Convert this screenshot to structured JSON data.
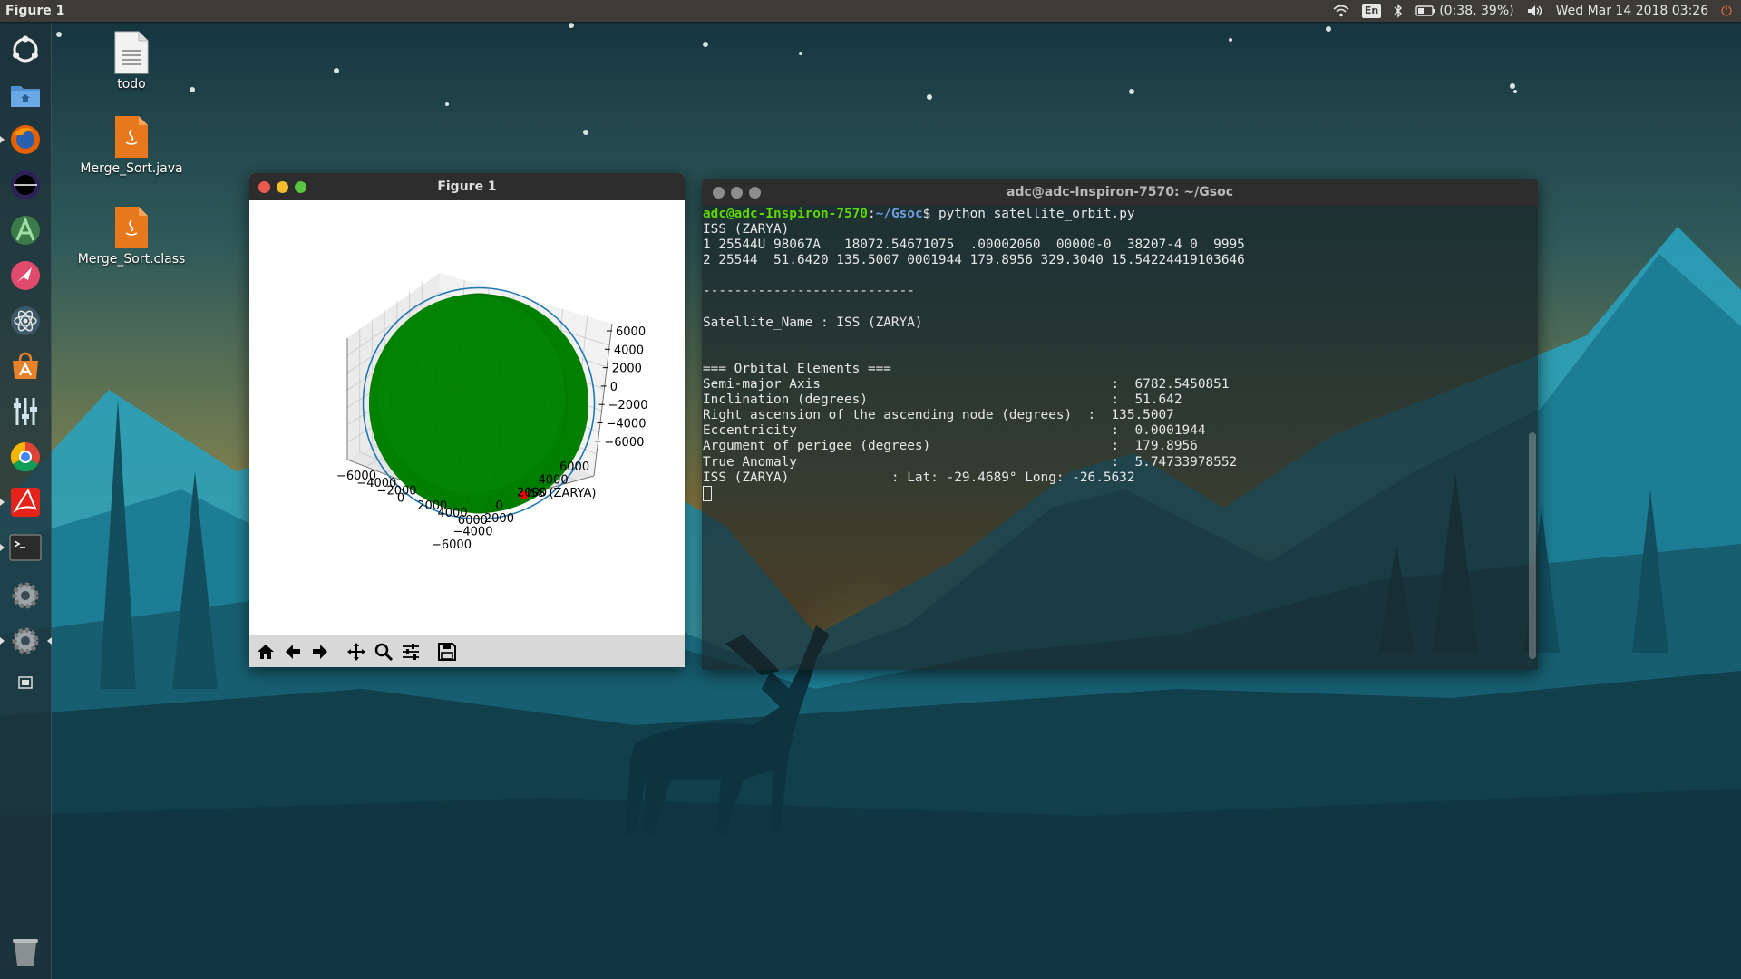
{
  "top_panel": {
    "active_app": "Figure 1",
    "language": "En",
    "battery": "(0:38, 39%)",
    "datetime": "Wed Mar 14 2018 03:26",
    "icons": [
      "wifi-icon",
      "bluetooth-icon",
      "battery-icon",
      "volume-icon",
      "power-icon"
    ]
  },
  "launcher": {
    "items": [
      "ubuntu-dash",
      "files",
      "firefox",
      "eclipse",
      "android-studio",
      "remote-desktop",
      "atom",
      "software-center",
      "mixer",
      "chrome",
      "pdf-reader",
      "terminal",
      "settings",
      "system-settings",
      "workspaces",
      "trash"
    ]
  },
  "desktop_icons": [
    {
      "label": "todo",
      "type": "text-file"
    },
    {
      "label": "Merge_Sort.java",
      "type": "java-file"
    },
    {
      "label": "Merge_Sort.class",
      "type": "java-file"
    }
  ],
  "figure_window": {
    "title": "Figure 1",
    "toolbar": [
      "home",
      "back",
      "forward",
      "pan",
      "zoom",
      "configure",
      "save"
    ]
  },
  "chart_data": {
    "type": "scatter",
    "title": "",
    "plot": "3d",
    "xlim": [
      -6000,
      6000
    ],
    "ylim": [
      -6000,
      6000
    ],
    "zlim": [
      -6000,
      6000
    ],
    "x_ticks": [
      "−6000",
      "−4000",
      "−2000",
      "0",
      "2000",
      "4000",
      "6000"
    ],
    "y_ticks": [
      "6000",
      "4000",
      "2000",
      "0",
      "−2000",
      "−4000",
      "−6000"
    ],
    "z_ticks": [
      "6000",
      "4000",
      "2000",
      "0",
      "−2000",
      "−4000",
      "−6000"
    ],
    "surface": {
      "shape": "sphere",
      "radius": 6371,
      "color": "#008000"
    },
    "orbit": {
      "semi_major_axis": 6782.5450851,
      "color": "#1f77b4"
    },
    "points": [
      {
        "label": "ISS (ZARYA)",
        "color": "#ff0000"
      }
    ]
  },
  "terminal": {
    "title": "adc@adc-Inspiron-7570: ~/Gsoc",
    "prompt_user": "adc@adc-Inspiron-7570",
    "prompt_path": "~/Gsoc",
    "command": "python satellite_orbit.py",
    "lines": [
      "ISS (ZARYA)",
      "1 25544U 98067A   18072.54671075  .00002060  00000-0  38207-4 0  9995",
      "2 25544  51.6420 135.5007 0001944 179.8956 329.3040 15.54224419103646",
      "",
      "---------------------------",
      "",
      "Satellite_Name : ISS (ZARYA)",
      "",
      "",
      "=== Orbital Elements ===",
      "Semi-major Axis                                     :  6782.5450851",
      "Inclination (degrees)                               :  51.642",
      "Right ascension of the ascending node (degrees)  :  135.5007",
      "Eccentricity                                        :  0.0001944",
      "Argument of perigee (degrees)                       :  179.8956",
      "True Anomaly                                        :  5.74733978552",
      "ISS (ZARYA)             : Lat: -29.4689° Long: -26.5632"
    ]
  }
}
